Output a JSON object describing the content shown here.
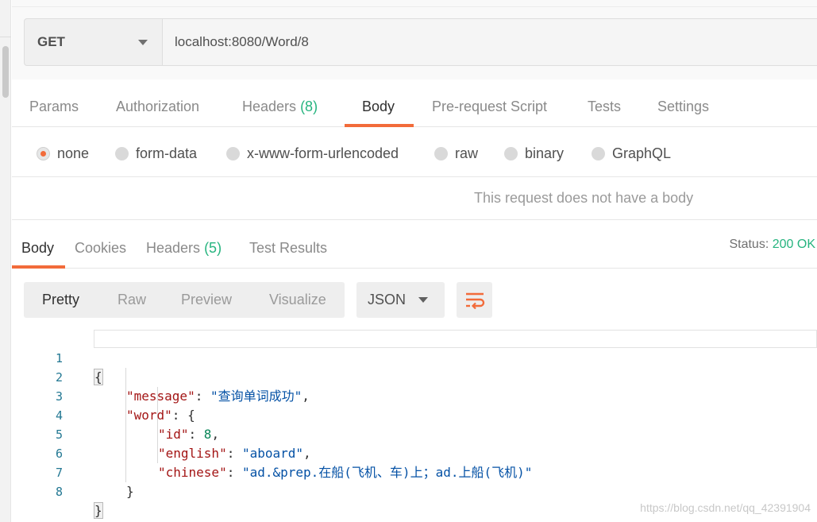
{
  "request": {
    "method": "GET",
    "url": "localhost:8080/Word/8"
  },
  "request_tabs": [
    {
      "label": "Params",
      "count": ""
    },
    {
      "label": "Authorization",
      "count": ""
    },
    {
      "label": "Headers",
      "count": "(8)"
    },
    {
      "label": "Body",
      "count": ""
    },
    {
      "label": "Pre-request Script",
      "count": ""
    },
    {
      "label": "Tests",
      "count": ""
    },
    {
      "label": "Settings",
      "count": ""
    }
  ],
  "body_types": [
    "none",
    "form-data",
    "x-www-form-urlencoded",
    "raw",
    "binary",
    "GraphQL"
  ],
  "no_body_message": "This request does not have a body",
  "response_tabs": [
    {
      "label": "Body",
      "count": ""
    },
    {
      "label": "Cookies",
      "count": ""
    },
    {
      "label": "Headers",
      "count": "(5)"
    },
    {
      "label": "Test Results",
      "count": ""
    }
  ],
  "status": {
    "label": "Status:",
    "value": "200 OK"
  },
  "view_modes": [
    "Pretty",
    "Raw",
    "Preview",
    "Visualize"
  ],
  "format": "JSON",
  "code": {
    "line_numbers": [
      "1",
      "2",
      "3",
      "4",
      "5",
      "6",
      "7",
      "8"
    ],
    "open_brace": "{",
    "message_key": "\"message\"",
    "message_value": "\"查询单词成功\"",
    "word_key": "\"word\"",
    "word_open": "{",
    "id_key": "\"id\"",
    "id_value": "8",
    "english_key": "\"english\"",
    "english_value": "\"aboard\"",
    "chinese_key": "\"chinese\"",
    "chinese_value": "\"ad.&prep.在船(飞机、车)上；ad.上船(飞机)\"",
    "word_close": "}",
    "close_brace": "}"
  },
  "watermark": "https://blog.csdn.net/qq_42391904",
  "colors": {
    "accent": "#f26b3a",
    "success": "#26b47f"
  },
  "icons": {
    "method_dropdown": "chevron-down-icon",
    "wrap": "wrap-lines-icon"
  }
}
